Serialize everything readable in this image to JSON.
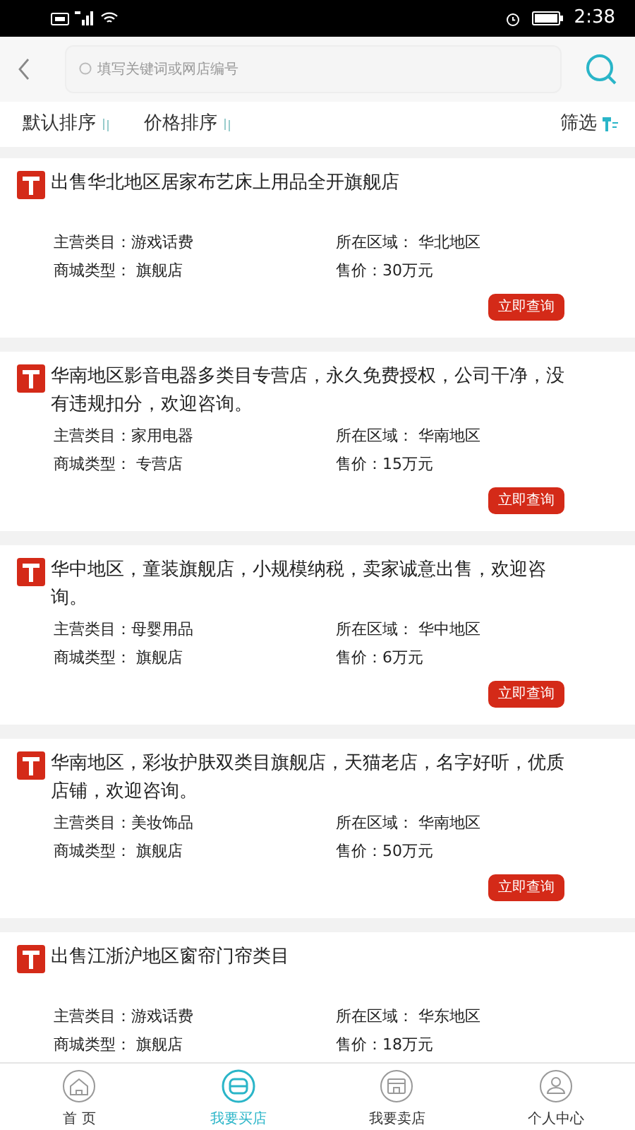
{
  "status_bar": {
    "time": "2:38"
  },
  "search": {
    "placeholder": "填写关键词或网店编号"
  },
  "sort_bar": [
    {
      "label": "默认排序",
      "kind": "sort"
    },
    {
      "label": "价格排序",
      "kind": "sort"
    },
    {
      "label": "筛选",
      "kind": "filter"
    }
  ],
  "listings": [
    {
      "title": "出售华北地区居家布艺床上用品全开旗舰店",
      "fields": [
        "主营类目：游戏话费",
        "所在区域： 华北地区",
        "商城类型： 旗舰店",
        "售价：30万元"
      ],
      "button": "立即查询"
    },
    {
      "title": "华南地区影音电器多类目专营店，永久免费授权，公司干净，没有违规扣分，欢迎咨询。",
      "fields": [
        "主营类目：家用电器",
        "所在区域： 华南地区",
        "商城类型： 专营店",
        "售价：15万元"
      ],
      "button": "立即查询"
    },
    {
      "title": "华中地区，童装旗舰店，小规模纳税，卖家诚意出售，欢迎咨询。",
      "fields": [
        "主营类目：母婴用品",
        "所在区域： 华中地区",
        "商城类型： 旗舰店",
        "售价：6万元"
      ],
      "button": "立即查询"
    },
    {
      "title": "华南地区，彩妆护肤双类目旗舰店，天猫老店，名字好听，优质店铺，欢迎咨询。",
      "fields": [
        "主营类目：美妆饰品",
        "所在区域： 华南地区",
        "商城类型： 旗舰店",
        "售价：50万元"
      ],
      "button": "立即查询"
    },
    {
      "title": "出售江浙沪地区窗帘门帘类目",
      "fields": [
        "主营类目：游戏话费",
        "所在区域： 华东地区",
        "商城类型： 旗舰店",
        "售价：18万元"
      ]
    }
  ],
  "bottom_nav": [
    {
      "label": "首 页",
      "kind": "home",
      "selected": false
    },
    {
      "label": "我要买店",
      "kind": "buy",
      "selected": true
    },
    {
      "label": "我要卖店",
      "kind": "sell",
      "selected": false
    },
    {
      "label": "个人中心",
      "kind": "user",
      "selected": false
    }
  ]
}
